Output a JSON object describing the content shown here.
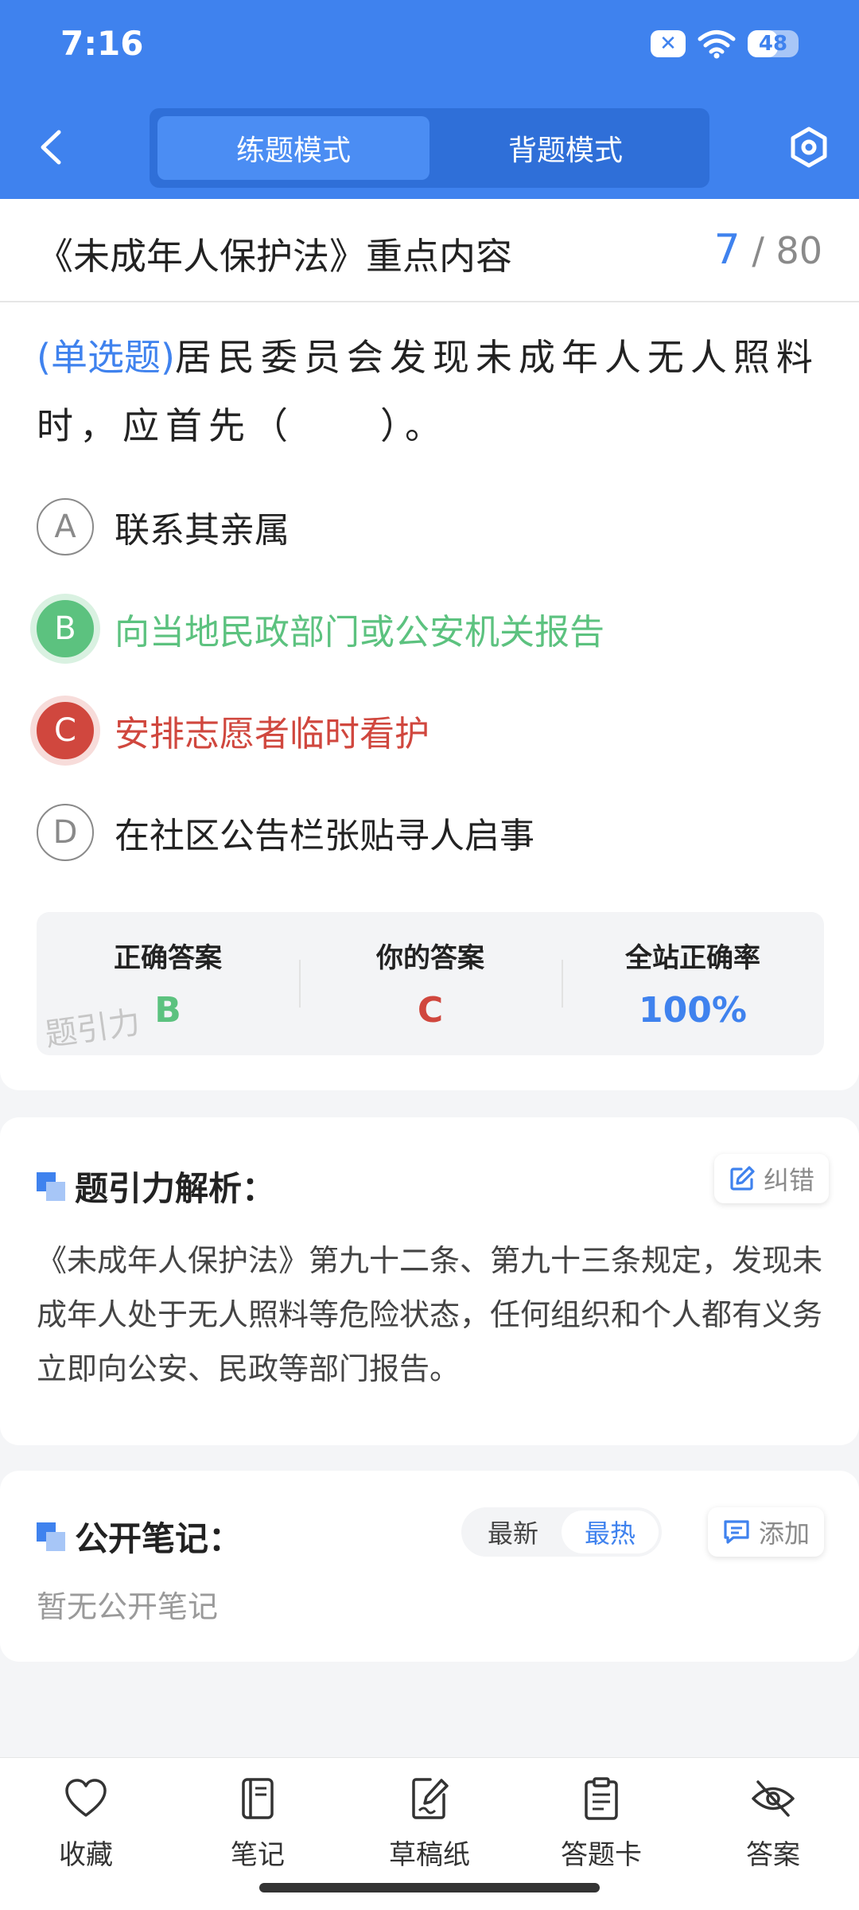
{
  "status_bar": {
    "time": "7:16",
    "battery": "48"
  },
  "header": {
    "tabs": [
      {
        "label": "练题模式",
        "active": true
      },
      {
        "label": "背题模式",
        "active": false
      }
    ]
  },
  "chapter": {
    "title": "《未成年人保护法》重点内容",
    "current": "7",
    "total": "/ 80"
  },
  "question": {
    "type": "(单选题)",
    "text": "居民委员会发现未成年人无人照料时，应首先（　　）。",
    "options": [
      {
        "letter": "A",
        "text": "联系其亲属",
        "state": "normal"
      },
      {
        "letter": "B",
        "text": "向当地民政部门或公安机关报告",
        "state": "correct"
      },
      {
        "letter": "C",
        "text": "安排志愿者临时看护",
        "state": "wrong"
      },
      {
        "letter": "D",
        "text": "在社区公告栏张贴寻人启事",
        "state": "normal"
      }
    ]
  },
  "answer_summary": {
    "correct_label": "正确答案",
    "correct_value": "B",
    "yours_label": "你的答案",
    "yours_value": "C",
    "rate_label": "全站正确率",
    "rate_value": "100%",
    "watermark": "题引力"
  },
  "analysis": {
    "title": "题引力解析：",
    "report_label": "纠错",
    "text": "《未成年人保护法》第九十二条、第九十三条规定，发现未成年人处于无人照料等危险状态，任何组织和个人都有义务立即向公安、民政等部门报告。"
  },
  "notes": {
    "title": "公开笔记：",
    "sort_tabs": [
      {
        "label": "最新",
        "active": false
      },
      {
        "label": "最热",
        "active": true
      }
    ],
    "add_label": "添加",
    "empty_text": "暂无公开笔记"
  },
  "bottom_bar": [
    {
      "label": "收藏",
      "icon": "heart-icon"
    },
    {
      "label": "笔记",
      "icon": "notebook-icon"
    },
    {
      "label": "草稿纸",
      "icon": "draft-icon"
    },
    {
      "label": "答题卡",
      "icon": "clipboard-icon"
    },
    {
      "label": "答案",
      "icon": "eye-off-icon"
    }
  ],
  "colors": {
    "primary": "#3f82ee",
    "correct": "#5cc27f",
    "wrong": "#d0473e"
  }
}
